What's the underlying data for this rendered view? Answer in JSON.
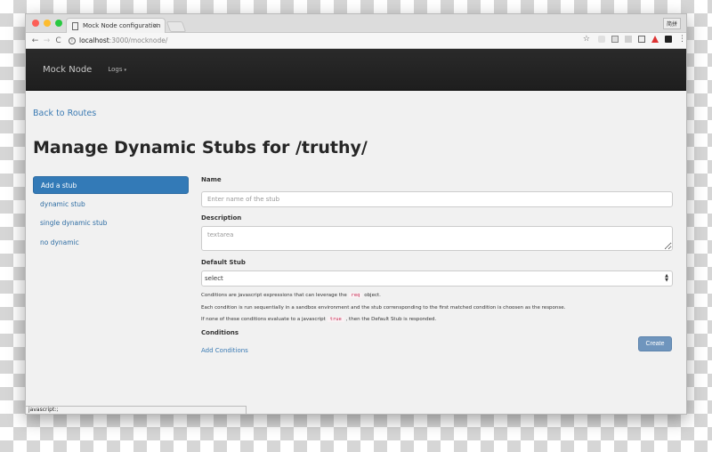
{
  "browser": {
    "tab_title": "Mock Node configuration",
    "tab_close": "×",
    "profile_label": "简拼",
    "url_host": "localhost",
    "url_rest": ":3000/mocknode/",
    "nav_back": "←",
    "nav_forward": "→",
    "nav_reload": "C",
    "info_icon": "i",
    "star_icon": "☆",
    "menu_icon": "⋮",
    "status_text": "javascript:;"
  },
  "navbar": {
    "brand": "Mock Node",
    "logs_label": "Logs",
    "logs_caret": "▾"
  },
  "page": {
    "back_link": "Back to Routes",
    "title": "Manage Dynamic Stubs for /truthy/"
  },
  "sidebar": {
    "items": [
      {
        "label": "Add a stub",
        "active": true
      },
      {
        "label": "dynamic stub",
        "active": false
      },
      {
        "label": "single dynamic stub",
        "active": false
      },
      {
        "label": "no dynamic",
        "active": false
      }
    ]
  },
  "form": {
    "name_label": "Name",
    "name_placeholder": "Enter name of the stub",
    "description_label": "Description",
    "description_placeholder": "textarea",
    "default_stub_label": "Default Stub",
    "default_stub_value": "select",
    "select_arrows": "▲▼",
    "help_line1_pre": "Conditions are javascript expressions that can leverage the",
    "help_line1_code": "req",
    "help_line1_post": "object.",
    "help_line2": "Each condition is run sequentially in a sandbox environment and the stub corrensponding to the first matched condition is choosen as the response.",
    "help_line3_pre": "If none of these conditions evaluate to a javascript",
    "help_line3_code": "true",
    "help_line3_post": ", then the Default Stub is responded.",
    "conditions_label": "Conditions",
    "add_conditions": "Add Conditions",
    "create_button": "Create"
  },
  "colors": {
    "accent": "#337ab7",
    "link": "#3a7ab3",
    "navbar": "#222222",
    "create_button": "#6f95bd",
    "code_text": "#c7254e"
  }
}
